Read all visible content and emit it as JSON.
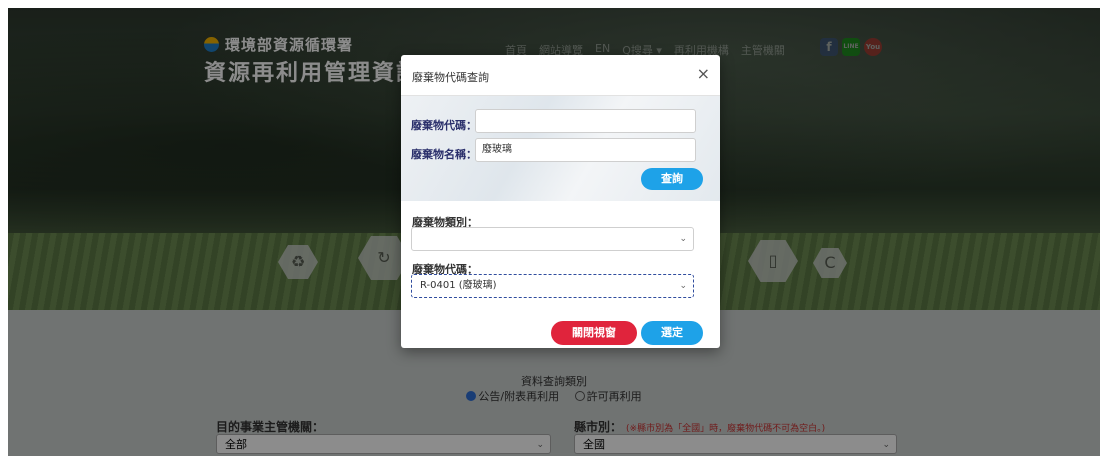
{
  "brand": {
    "agency": "環境部資源循環署",
    "system": "資源再利用管理資訊系"
  },
  "nav": {
    "items": [
      "首頁",
      "網站導覽",
      "EN",
      "Q搜尋 ▾",
      "再利用機構",
      "主管機關"
    ]
  },
  "social": {
    "facebook": "f",
    "line": "LINE",
    "youtube": "You"
  },
  "hex_icons": [
    "recycle-icon",
    "phone-icon",
    "shield-icon"
  ],
  "query": {
    "title": "資料查詢類別",
    "options": [
      {
        "label": "公告/附表再利用",
        "checked": true
      },
      {
        "label": "許可再利用",
        "checked": false
      }
    ],
    "authority_label": "目的事業主管機關：",
    "authority_value": "全部",
    "county_label": "縣市別：",
    "county_note": "(※縣市別為「全國」時，廢棄物代碼不可為空白。)",
    "county_value": "全國"
  },
  "modal": {
    "title": "廢棄物代碼查詢",
    "close": "×",
    "code_label": "廢棄物代碼：",
    "code_value": "",
    "name_label": "廢棄物名稱：",
    "name_value": "廢玻璃",
    "search_button": "查詢",
    "category_label": "廢棄物類別：",
    "category_value": "",
    "code_select_label": "廢棄物代碼：",
    "code_select_value": "R-0401 (廢玻璃)",
    "close_button": "關閉視窗",
    "confirm_button": "選定"
  },
  "colors": {
    "primary": "#1ea2e8",
    "danger": "#e0243c",
    "label": "#2a2f6b"
  }
}
